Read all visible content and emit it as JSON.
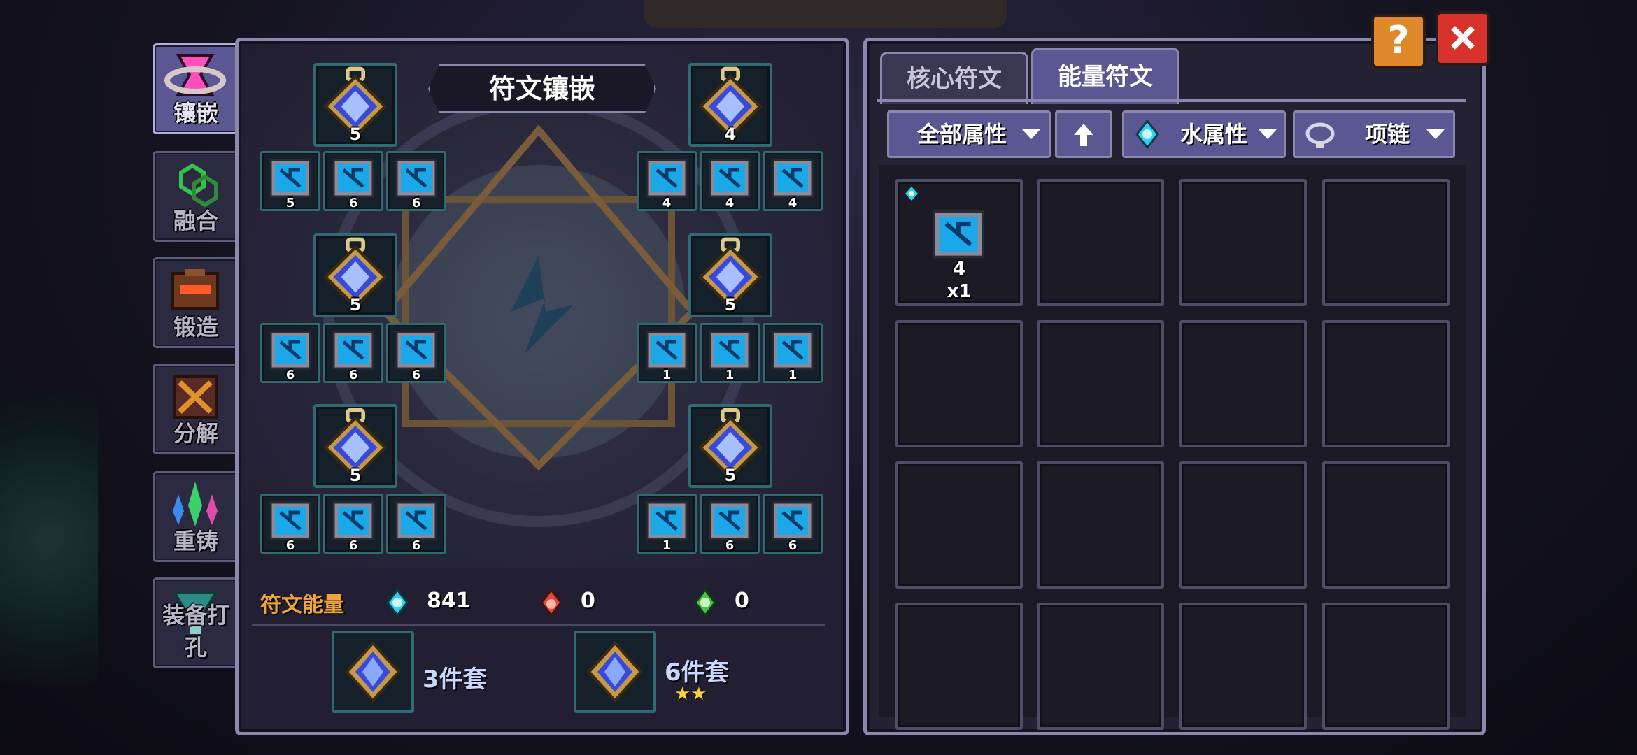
{
  "side_tabs": [
    {
      "label": "镶嵌",
      "icon": "hourglass-icon",
      "active": true
    },
    {
      "label": "融合",
      "icon": "fusion-rings-icon",
      "active": false
    },
    {
      "label": "锻造",
      "icon": "forge-chest-icon",
      "active": false
    },
    {
      "label": "分解",
      "icon": "decompose-icon",
      "active": false
    },
    {
      "label": "重铸",
      "icon": "recast-crystals-icon",
      "active": false
    },
    {
      "label": "装备打孔",
      "icon": "drill-socket-icon",
      "active": false
    }
  ],
  "panel": {
    "title": "符文镶嵌"
  },
  "rune_slots": {
    "core_left": [
      "5",
      "5",
      "5"
    ],
    "core_right": [
      "4",
      "5",
      "5"
    ],
    "small_left_row1": [
      "5",
      "6",
      "6"
    ],
    "small_right_row1": [
      "4",
      "4",
      "4"
    ],
    "small_left_row2": [
      "6",
      "6",
      "6"
    ],
    "small_right_row2": [
      "1",
      "1",
      "1"
    ],
    "small_left_row3": [
      "6",
      "6",
      "6"
    ],
    "small_right_row3": [
      "1",
      "6",
      "6"
    ]
  },
  "energy": {
    "label": "符文能量",
    "water": "841",
    "fire": "0",
    "nature": "0"
  },
  "sets": [
    {
      "label": "3件套",
      "stars": ""
    },
    {
      "label": "6件套",
      "stars": "★★"
    }
  ],
  "tabs": [
    {
      "label": "核心符文",
      "active": false
    },
    {
      "label": "能量符文",
      "active": true
    }
  ],
  "filters": {
    "all_attr": "全部属性",
    "sort_icon": "up-arrow-icon",
    "element": "水属性",
    "slot_type": "项链"
  },
  "inventory": [
    {
      "level": "4",
      "count": "x1"
    }
  ],
  "colors": {
    "accent": "#5b5792",
    "water": "#2fd3f0",
    "fire": "#e04a3a",
    "nature": "#4cc24a",
    "energy_label": "#f0a53a",
    "close": "#d8322c",
    "help": "#e0892a"
  }
}
